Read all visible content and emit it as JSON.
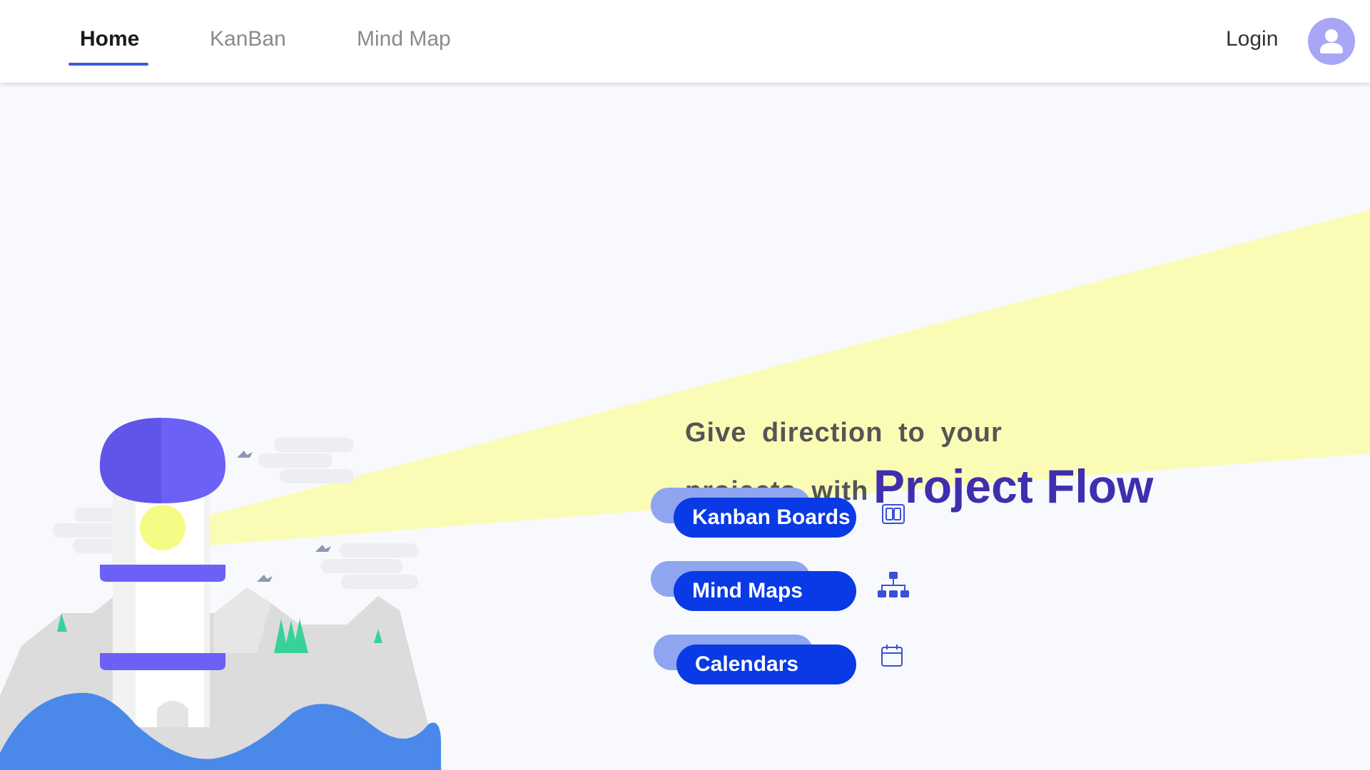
{
  "nav": {
    "tabs": [
      {
        "label": "Home",
        "active": true
      },
      {
        "label": "KanBan",
        "active": false
      },
      {
        "label": "Mind Map",
        "active": false
      }
    ],
    "login_label": "Login",
    "avatar_icon": "user-icon"
  },
  "hero": {
    "line1": "Give direction to your",
    "line2": "projects with",
    "brand": "Project Flow"
  },
  "features": [
    {
      "label": "Kanban Boards",
      "icon": "kanban-board-icon"
    },
    {
      "label": "Mind Maps",
      "icon": "sitemap-icon"
    },
    {
      "label": "Calendars",
      "icon": "calendar-icon"
    }
  ],
  "colors": {
    "accent": "#0a3ae6",
    "brand_text": "#3f2fae",
    "light_beam": "#fafcb6",
    "lighthouse_cap": "#6b61f7"
  }
}
